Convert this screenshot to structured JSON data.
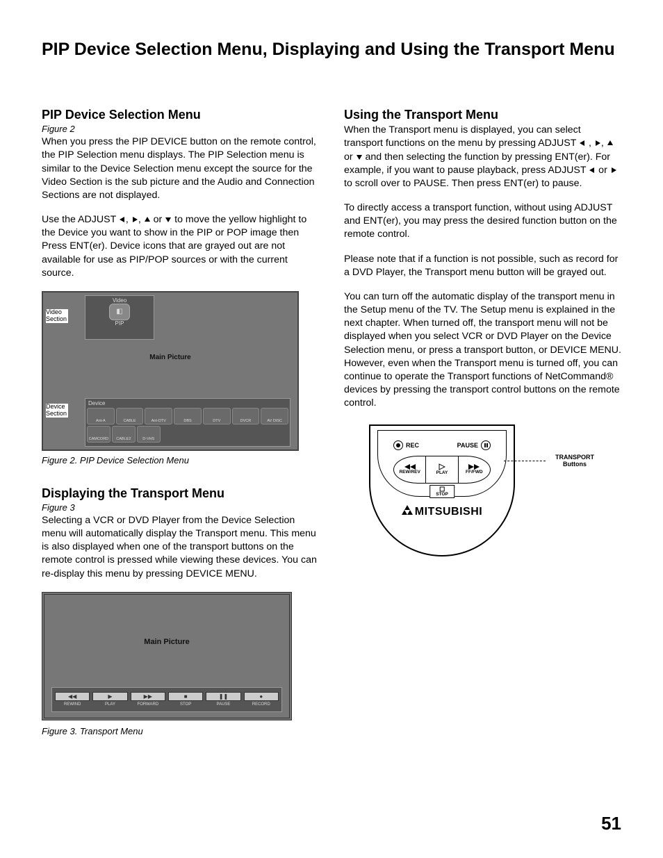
{
  "page_title": "PIP Device Selection Menu,  Displaying and Using the Transport Menu",
  "page_number": "51",
  "left": {
    "sec1": {
      "head": "PIP Device Selection Menu",
      "figref": "Figure 2",
      "p1": "When you press the PIP DEVICE button on the remote control, the PIP Selection menu displays.  The PIP Selection menu is similar to the Device Selection menu except the source for the Video Section is the sub picture and the Audio and Connection Sections are not displayed.",
      "p2a": "Use the ADJUST ",
      "p2b": ", ",
      "p2c": ", ",
      "p2d": " or ",
      "p2e": "  to move the yellow highlight to the Device you want to show in the PIP or POP image then Press ENT(er).  Device icons that are grayed out are not available for use as PIP/POP sources or with the current source.",
      "fig2": {
        "video_section": "Video\nSection",
        "device_section": "Device\nSection",
        "top_label1": "Video",
        "top_label2": "PIP",
        "main": "Main Picture",
        "dev_label": "Device",
        "row1": [
          "Ant-A",
          "CABLE",
          "Ant-DTV",
          "DBS",
          "DTV",
          "DVCR",
          "AV DISC"
        ],
        "row2": [
          "CAMCORD",
          "CABLE2",
          "D-VHS"
        ],
        "caption": "Figure 2. PIP Device Selection Menu"
      }
    },
    "sec2": {
      "head": "Displaying the Transport Menu",
      "figref": "Figure 3",
      "p1": "Selecting a VCR or DVD Player from the Device Selection menu will automatically display the Transport menu.  This menu is also displayed when one of the transport buttons on the remote control is pressed while viewing these devices.  You can re-display this menu by pressing DEVICE MENU.",
      "fig3": {
        "main": "Main Picture",
        "buttons": [
          {
            "sym": "◀◀",
            "label": "REWIND"
          },
          {
            "sym": "▶",
            "label": "PLAY"
          },
          {
            "sym": "▶▶",
            "label": "FORWARD"
          },
          {
            "sym": "■",
            "label": "STOP"
          },
          {
            "sym": "❚❚",
            "label": "PAUSE"
          },
          {
            "sym": "●",
            "label": "RECORD"
          }
        ],
        "caption": "Figure 3.  Transport Menu"
      }
    }
  },
  "right": {
    "sec1": {
      "head": "Using the Transport Menu",
      "p1a": "When the Transport menu is displayed, you can select transport functions on the menu by pressing ADJUST ",
      "p1b": " , ",
      "p1c": ", ",
      "p1d": " or ",
      "p1e": " and then selecting the function by pressing ENT(er).  For example, if you want to pause playback, press ADJUST ",
      "p1f": " or ",
      "p1g": " to scroll over to PAUSE.  Then press ENT(er) to pause.",
      "p2": "To directly access a transport function, without using ADJUST and ENT(er), you may press the desired function button on the remote control.",
      "p3": "Please note that if a function is not possible, such as record for a DVD Player, the Transport menu button will be grayed out.",
      "p4": "You can turn off the automatic display of the transport menu in the Setup menu of the TV.  The Setup menu is explained in the next chapter.  When turned off, the transport menu will not be displayed when you select VCR or DVD Player on the Device Selection menu, or press a transport button, or DEVICE MENU.  However, even when the Transport menu is turned off, you can continue to operate the Transport functions of NetCommand® devices by pressing the transport control buttons on the remote control."
    },
    "remote": {
      "rec": "REC",
      "pause": "PAUSE",
      "play": "PLAY",
      "rew": "REW/REV",
      "ff": "FF/FWD",
      "stop": "STOP",
      "brand": "MITSUBISHI",
      "label": "TRANSPORT\nButtons"
    }
  }
}
